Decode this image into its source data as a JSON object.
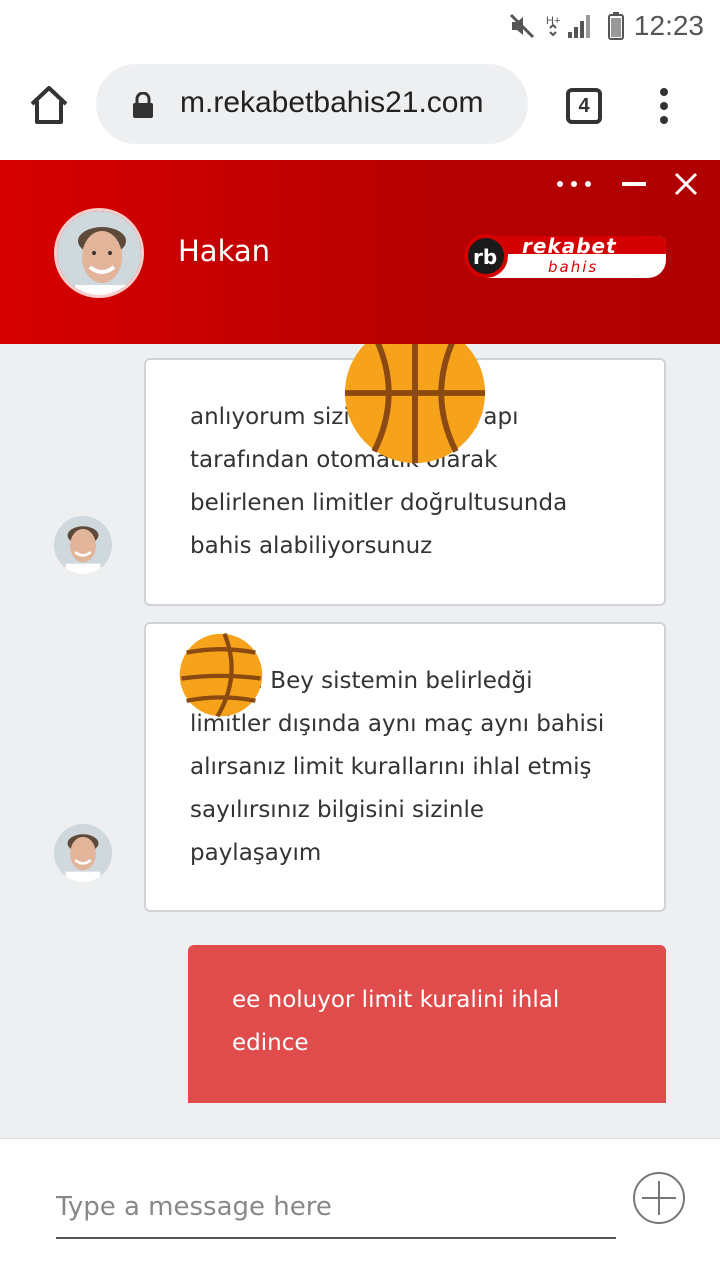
{
  "status_bar": {
    "time": "12:23",
    "icons": [
      "mute-icon",
      "signal-icon",
      "battery-icon"
    ]
  },
  "browser": {
    "url": "m.rekabetbahis21.com",
    "tab_count": "4",
    "icons": [
      "home-icon",
      "lock-icon",
      "more-vert-icon"
    ]
  },
  "chat_header": {
    "agent_name": "Hakan",
    "brand_word": "rekabet",
    "brand_sub": "bahis",
    "brand_mark": "rb",
    "icons": [
      "more-horiz-icon",
      "minimize-icon",
      "close-icon"
    ],
    "colors": {
      "header_start": "#d70000",
      "header_end": "#b00000"
    }
  },
  "messages": [
    {
      "from": "agent",
      "text": "anlıyorum sizi sistem altyapı\ntarafından otomatik olarak\nbelirlenen limitler doğrultusunda\nbahis alabiliyorsunuz"
    },
    {
      "from": "agent",
      "text": "Hakan Bey sistemin belirledği\nlimitler dışında aynı maç aynı bahisi\nalırsanız limit kurallarını ihlal etmiş\nsayılırsınız bilgisini sizinle\npaylaşayım"
    },
    {
      "from": "user",
      "text": "ee noluyor limit kuralini ihlal\nedince"
    }
  ],
  "composer": {
    "placeholder": "Type a message here",
    "value": "",
    "icons": [
      "add-icon"
    ],
    "colors": {
      "user_bubble": "#e04c4c",
      "bg": "#eeeff1"
    }
  }
}
